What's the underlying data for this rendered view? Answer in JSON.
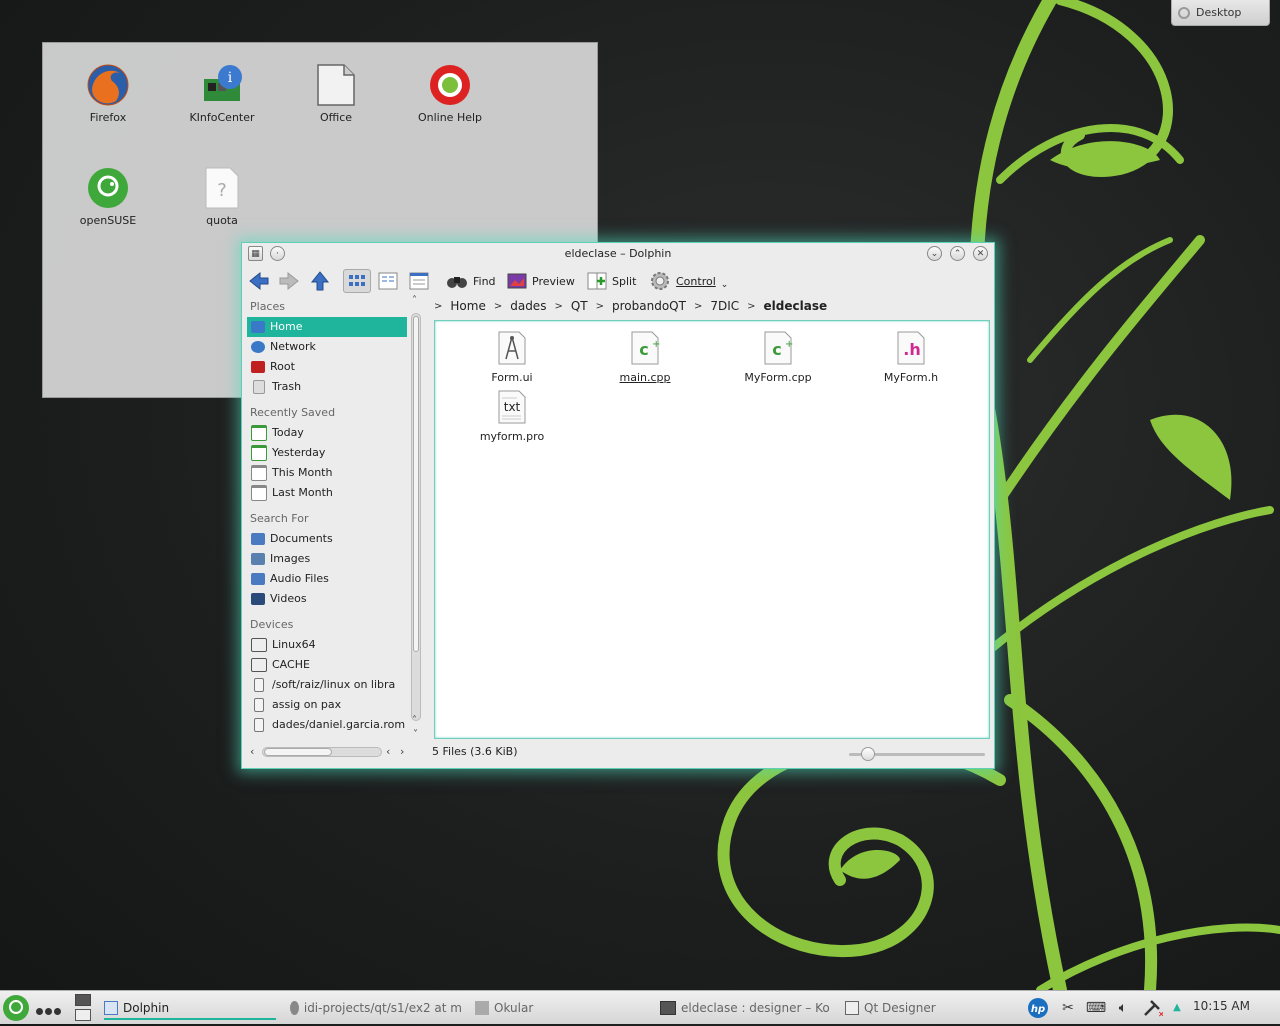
{
  "cashew": {
    "label": "Desktop"
  },
  "desktop_icons": [
    {
      "label": "Firefox",
      "icon": "firefox-icon"
    },
    {
      "label": "KInfoCenter",
      "icon": "kinfocenter-icon"
    },
    {
      "label": "Office",
      "icon": "office-document-icon"
    },
    {
      "label": "Online Help",
      "icon": "online-help-icon"
    },
    {
      "label": "openSUSE",
      "icon": "opensuse-icon"
    },
    {
      "label": "quota",
      "icon": "unknown-file-icon"
    }
  ],
  "dolphin": {
    "title": "eldeclase – Dolphin",
    "toolbar": {
      "find_label": "Find",
      "preview_label": "Preview",
      "split_label": "Split",
      "control_label": "Control"
    },
    "sidebar": {
      "places_header": "Places",
      "places": [
        {
          "label": "Home",
          "selected": true,
          "color": "#3a78c8"
        },
        {
          "label": "Network",
          "selected": false,
          "color": "#3a78c8"
        },
        {
          "label": "Root",
          "selected": false,
          "color": "#c02020"
        },
        {
          "label": "Trash",
          "selected": false,
          "color": "#d8d8d8"
        }
      ],
      "recent_header": "Recently Saved",
      "recent": [
        {
          "label": "Today"
        },
        {
          "label": "Yesterday"
        },
        {
          "label": "This Month"
        },
        {
          "label": "Last Month"
        }
      ],
      "search_header": "Search For",
      "search": [
        {
          "label": "Documents"
        },
        {
          "label": "Images"
        },
        {
          "label": "Audio Files"
        },
        {
          "label": "Videos"
        }
      ],
      "devices_header": "Devices",
      "devices": [
        {
          "label": "Linux64"
        },
        {
          "label": "CACHE"
        },
        {
          "label": "/soft/raiz/linux on libra"
        },
        {
          "label": "assig on pax"
        },
        {
          "label": "dades/daniel.garcia.rom"
        }
      ]
    },
    "breadcrumb": [
      "Home",
      "dades",
      "QT",
      "probandoQT",
      "7DIC",
      "eldeclase"
    ],
    "files": [
      {
        "name": "Form.ui",
        "type": "ui"
      },
      {
        "name": "main.cpp",
        "type": "cpp"
      },
      {
        "name": "MyForm.cpp",
        "type": "cpp"
      },
      {
        "name": "MyForm.h",
        "type": "h"
      },
      {
        "name": "myform.pro",
        "type": "txt"
      }
    ],
    "status": "5 Files (3.6 KiB)",
    "zoom_level": 0.1
  },
  "taskbar": {
    "tasks": [
      {
        "label": "Dolphin"
      },
      {
        "label": "idi-projects/qt/s1/ex2 at m"
      },
      {
        "label": "Okular"
      },
      {
        "label": "eldeclase : designer – Ko"
      },
      {
        "label": "Qt Designer"
      }
    ],
    "clock": "10:15 AM"
  }
}
